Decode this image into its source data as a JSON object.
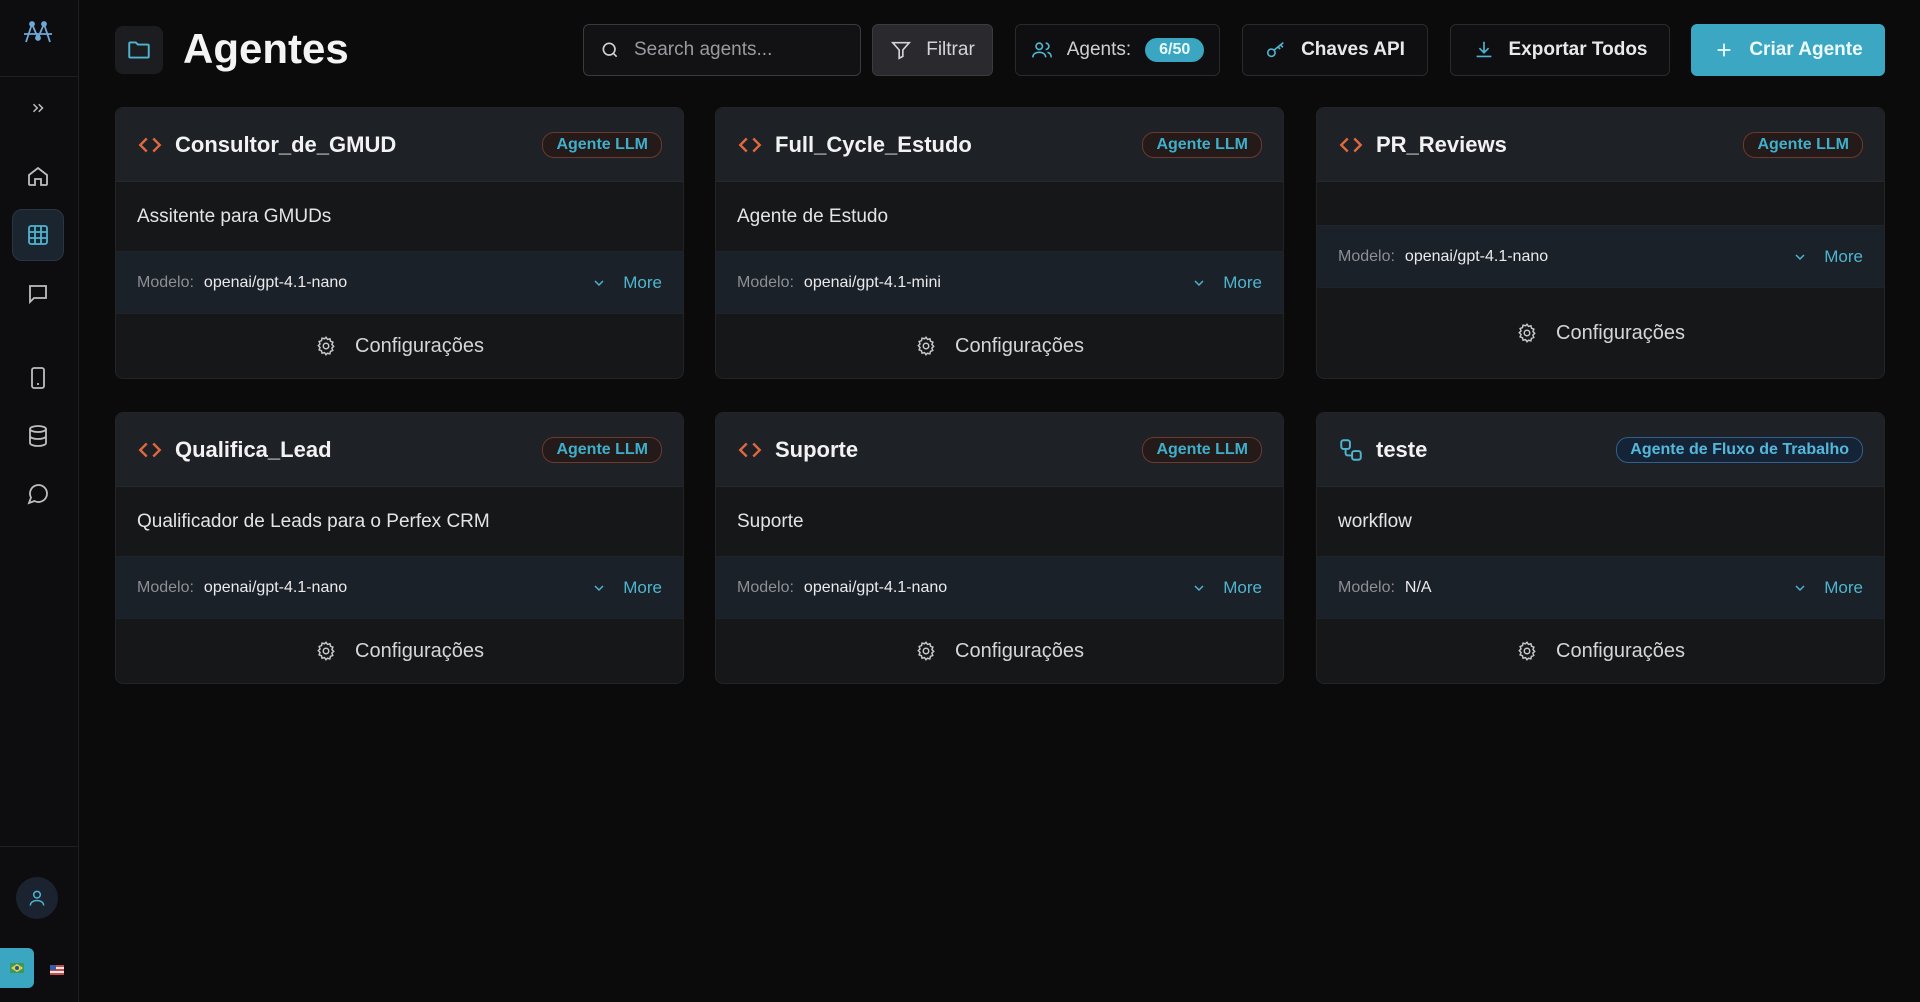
{
  "header": {
    "title": "Agentes",
    "search_placeholder": "Search agents...",
    "filter_label": "Filtrar",
    "agents_label": "Agents:",
    "agents_count": "6/50",
    "api_keys_label": "Chaves API",
    "export_label": "Exportar Todos",
    "create_label": "Criar Agente"
  },
  "colors": {
    "accent": "#3ba7c3",
    "code_icon": "#e0683f",
    "background": "#0b0b0c"
  },
  "agents": [
    {
      "name": "Consultor_de_GMUD",
      "type": "Agente LLM",
      "icon": "code-icon",
      "description": "Assitente para GMUDs",
      "model_label": "Modelo:",
      "model": "openai/gpt-4.1-nano",
      "more": "More",
      "settings": "Configurações"
    },
    {
      "name": "Full_Cycle_Estudo",
      "type": "Agente LLM",
      "icon": "code-icon",
      "description": "Agente de Estudo",
      "model_label": "Modelo:",
      "model": "openai/gpt-4.1-mini",
      "more": "More",
      "settings": "Configurações"
    },
    {
      "name": "PR_Reviews",
      "type": "Agente LLM",
      "icon": "code-icon",
      "description": "",
      "model_label": "Modelo:",
      "model": "openai/gpt-4.1-nano",
      "more": "More",
      "settings": "Configurações"
    },
    {
      "name": "Qualifica_Lead",
      "type": "Agente LLM",
      "icon": "code-icon",
      "description": "Qualificador de Leads para o Perfex CRM",
      "model_label": "Modelo:",
      "model": "openai/gpt-4.1-nano",
      "more": "More",
      "settings": "Configurações"
    },
    {
      "name": "Suporte",
      "type": "Agente LLM",
      "icon": "code-icon",
      "description": "Suporte",
      "model_label": "Modelo:",
      "model": "openai/gpt-4.1-nano",
      "more": "More",
      "settings": "Configurações"
    },
    {
      "name": "teste",
      "type": "Agente de Fluxo de Trabalho",
      "icon": "workflow-icon",
      "description": "workflow",
      "model_label": "Modelo:",
      "model": "N/A",
      "more": "More",
      "settings": "Configurações"
    }
  ]
}
